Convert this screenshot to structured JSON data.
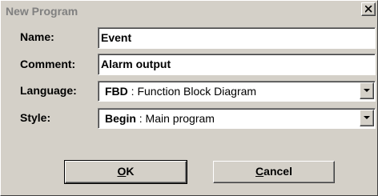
{
  "window": {
    "title": "New Program",
    "close_icon": "close-x-icon"
  },
  "form": {
    "name_label": "Name:",
    "name_value": "Event",
    "comment_label": "Comment:",
    "comment_value": "Alarm output",
    "language_label": "Language:",
    "language_code": "FBD",
    "language_desc": " : Function Block Diagram",
    "style_label": "Style:",
    "style_code": "Begin",
    "style_desc": " : Main program",
    "dropdown_icon": "chevron-down-icon"
  },
  "buttons": {
    "ok_mnemonic": "O",
    "ok_rest": "K",
    "cancel_mnemonic": "C",
    "cancel_rest": "ancel"
  }
}
